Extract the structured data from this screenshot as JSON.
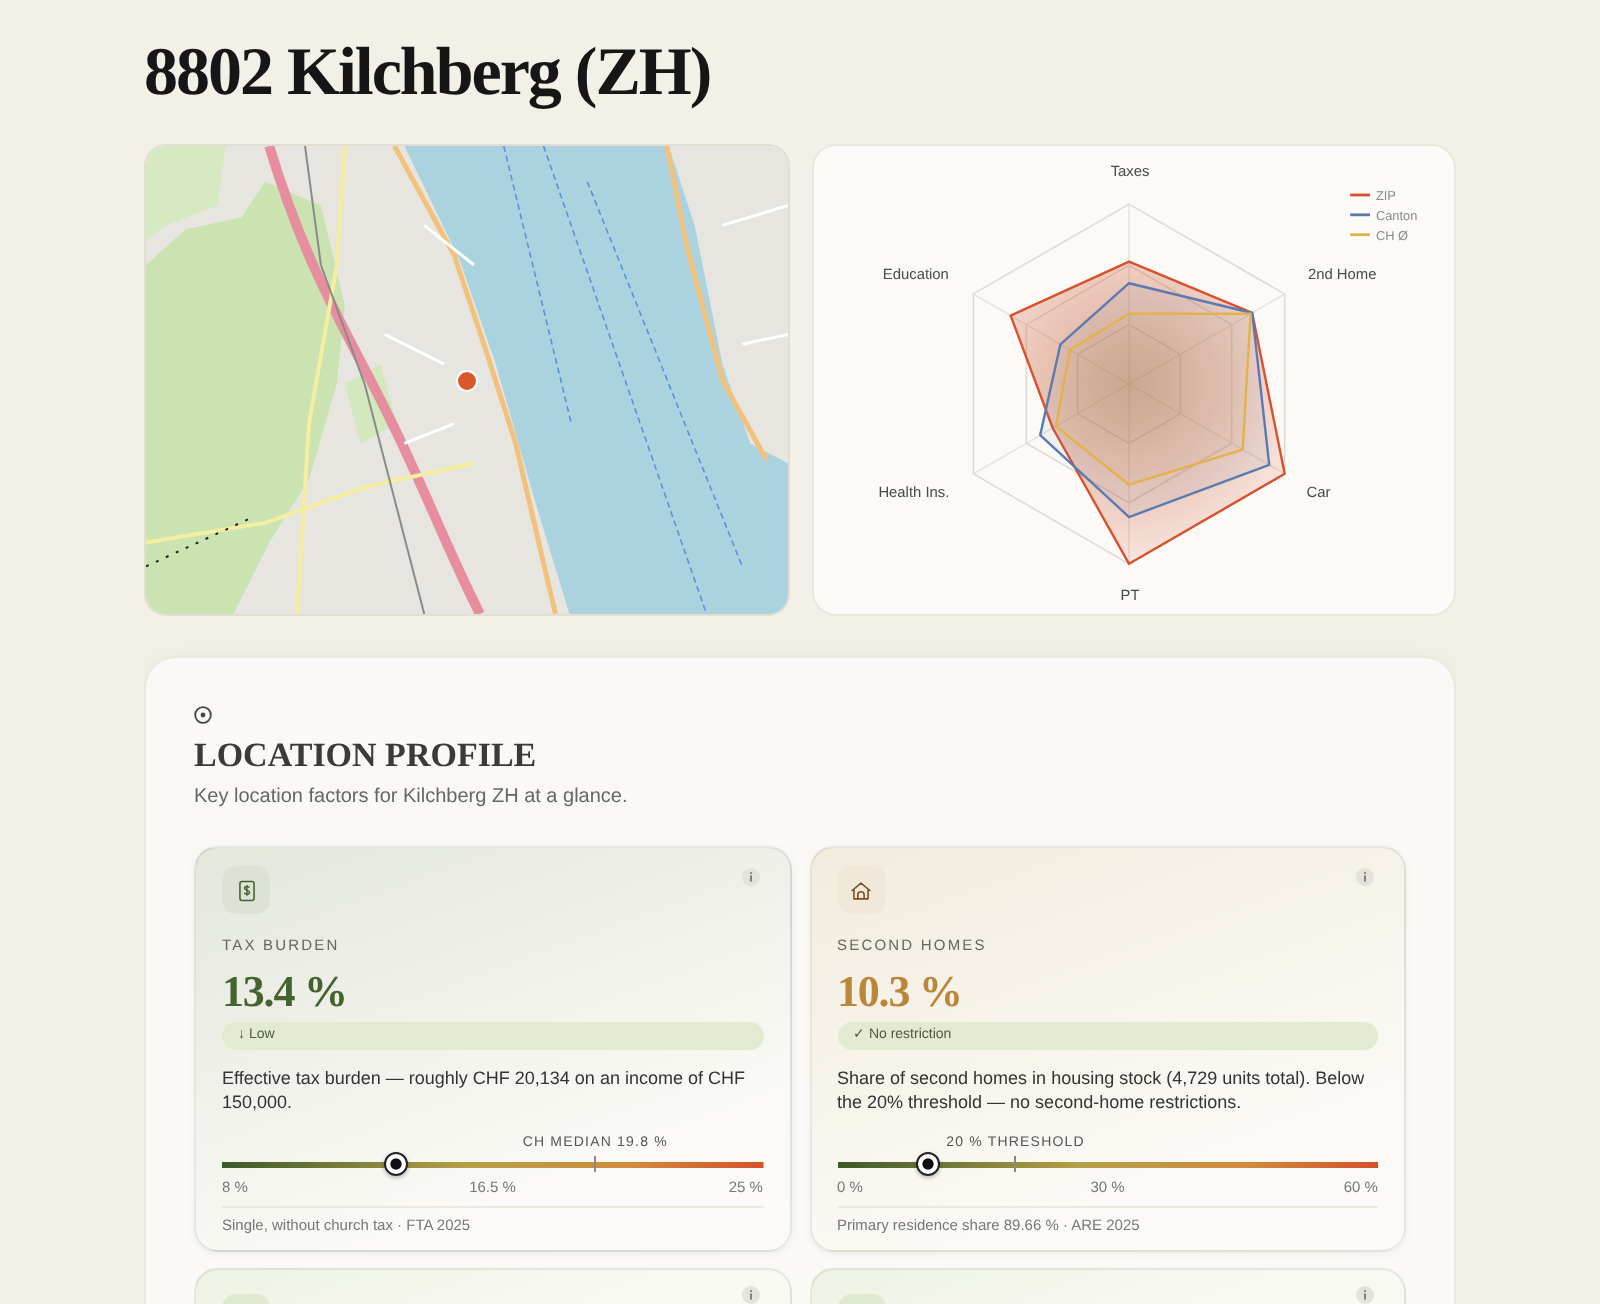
{
  "title": "8802 Kilchberg (ZH)",
  "radar": {
    "axes": [
      "Taxes",
      "2nd Home",
      "Car",
      "PT",
      "Health Ins.",
      "Education"
    ],
    "legend": [
      {
        "label": "ZIP",
        "color": "#d9502e"
      },
      {
        "label": "Canton",
        "color": "#5b7bb0"
      },
      {
        "label": "CH Ø",
        "color": "#e3b24a"
      }
    ]
  },
  "profile": {
    "title": "LOCATION PROFILE",
    "subtitle": "Key location factors for Kilchberg ZH at a glance.",
    "cards": [
      {
        "kind": "tax",
        "color": "#44632f",
        "label": "TAX BURDEN",
        "value": "13.4 %",
        "badge": "↓ Low",
        "description": "Effective tax burden — roughly CHF 20,134 on an income of CHF 150,000.",
        "scale": {
          "level": 0.32,
          "marker": {
            "label": "CH MEDIAN 19.8 %",
            "level": 0.69
          },
          "ticks": [
            "8 %",
            "16.5 %",
            "25 %"
          ]
        },
        "footnote": "Single, without church tax · FTA 2025"
      },
      {
        "kind": "homes",
        "color": "#b8873a",
        "label": "SECOND HOMES",
        "value": "10.3 %",
        "badge": "✓ No restriction",
        "description": "Share of second homes in housing stock (4,729 units total). Below the 20% threshold — no second-home restrictions.",
        "scale": {
          "level": 0.17,
          "marker": {
            "label": "20 % THRESHOLD",
            "level": 0.33
          },
          "ticks": [
            "0 %",
            "30 %",
            "60 %"
          ]
        },
        "footnote": "Primary residence share 89.66 % · ARE 2025"
      },
      {
        "kind": "partial"
      },
      {
        "kind": "partial"
      }
    ]
  }
}
